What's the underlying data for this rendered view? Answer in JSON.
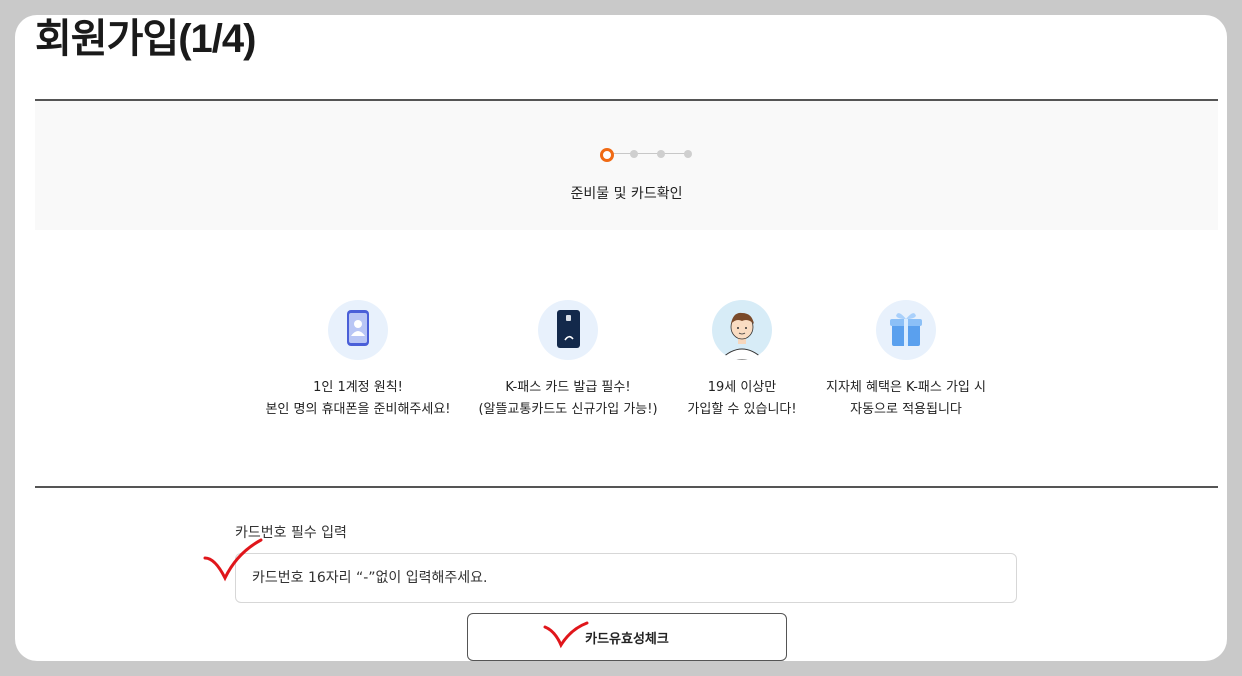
{
  "page": {
    "title": "회원가입(1/4)"
  },
  "stepper": {
    "current_step": 1,
    "total_steps": 4,
    "current_label": "준비물 및 카드확인",
    "accent_color": "#f06a14"
  },
  "features": [
    {
      "icon": "smartphone-person-icon",
      "text": "1인 1계정 원칙!\n본인 명의 휴대폰을 준비해주세요!"
    },
    {
      "icon": "transit-card-icon",
      "text": "K-패스 카드 발급 필수!\n(알뜰교통카드도 신규가입 가능!)"
    },
    {
      "icon": "person-avatar-icon",
      "text": "19세 이상만\n가입할 수 있습니다!"
    },
    {
      "icon": "gift-box-icon",
      "text": "지자체 혜택은 K-패스 가입 시\n자동으로 적용됩니다"
    }
  ],
  "card_form": {
    "label": "카드번호 필수 입력",
    "input_placeholder": "카드번호 16자리 “-”없이 입력해주세요.",
    "check_button_label": "카드유효성체크"
  },
  "annotations": {
    "checkmark_color": "#e0161b"
  }
}
